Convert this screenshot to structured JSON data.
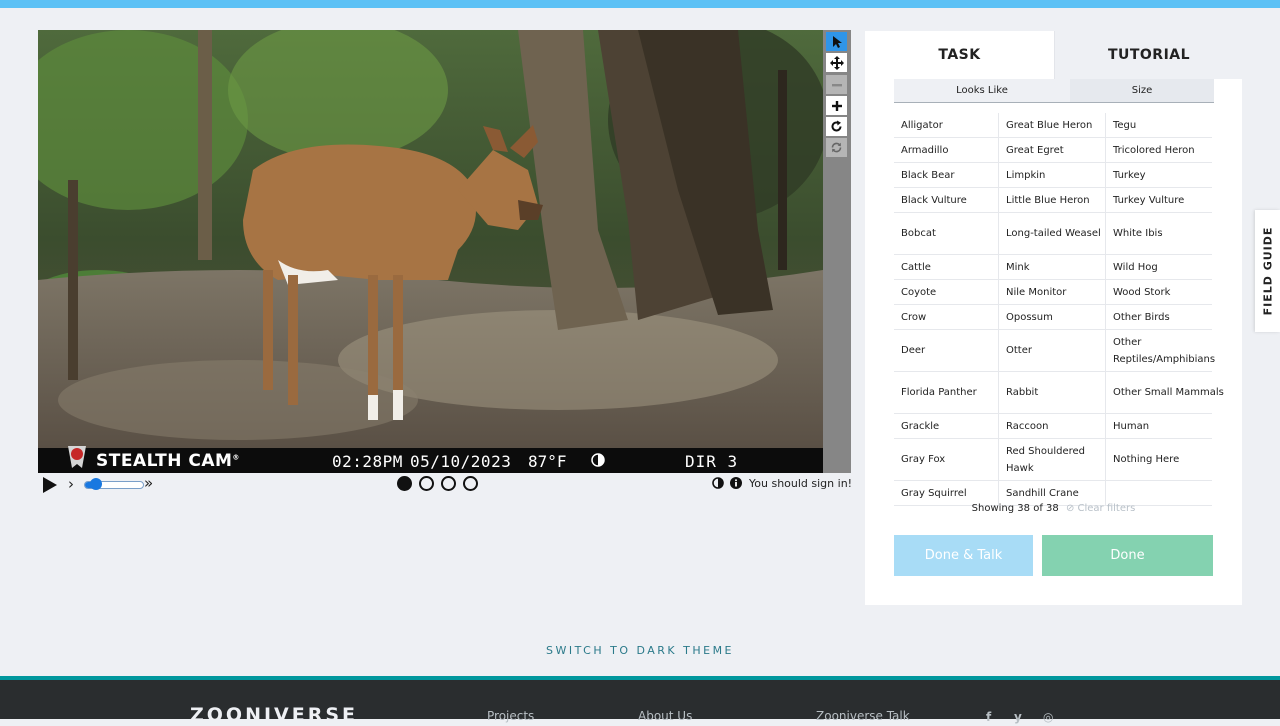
{
  "camera": {
    "brand": "STEALTH CAM",
    "brand_mark": "®",
    "time": "02:28PM",
    "date": "05/10/2023",
    "temp": "87°F",
    "dir": "DIR 3"
  },
  "toolbar": {
    "icons": [
      "pointer-icon",
      "move-icon",
      "zoom-out-icon",
      "zoom-in-icon",
      "rotate-icon",
      "reset-icon"
    ]
  },
  "controls": {
    "slow_label": "›",
    "fast_label": "»",
    "frames_total": 4,
    "frame_current": 1,
    "signin_note": "You should sign in!"
  },
  "task": {
    "tabs": {
      "task": "TASK",
      "tutorial": "TUTORIAL"
    },
    "filters": {
      "looks_like": "Looks Like",
      "size": "Size"
    },
    "rows": [
      [
        "Alligator",
        "Great Blue Heron",
        "Tegu"
      ],
      [
        "Armadillo",
        "Great Egret",
        "Tricolored Heron"
      ],
      [
        "Black Bear",
        "Limpkin",
        "Turkey"
      ],
      [
        "Black Vulture",
        "Little Blue Heron",
        "Turkey Vulture"
      ],
      [
        "Bobcat",
        "Long-tailed Weasel",
        "White Ibis"
      ],
      [
        "Cattle",
        "Mink",
        "Wild Hog"
      ],
      [
        "Coyote",
        "Nile Monitor",
        "Wood Stork"
      ],
      [
        "Crow",
        "Opossum",
        "Other Birds"
      ],
      [
        "Deer",
        "Otter",
        "Other Reptiles/Amphibians"
      ],
      [
        "Florida Panther",
        "Rabbit",
        "Other Small Mammals"
      ],
      [
        "Grackle",
        "Raccoon",
        "Human"
      ],
      [
        "Gray Fox",
        "Red Shouldered Hawk",
        "Nothing Here"
      ],
      [
        "Gray Squirrel",
        "Sandhill Crane",
        ""
      ]
    ],
    "showing": "Showing 38 of 38",
    "clear_filters": "Clear filters",
    "done_talk": "Done & Talk",
    "done": "Done"
  },
  "field_guide": "FIELD GUIDE",
  "theme_toggle": "SWITCH TO DARK THEME",
  "footer": {
    "logo": "ZOONIVERSE",
    "links": [
      "Projects",
      "About Us",
      "Zooniverse Talk"
    ],
    "social": [
      "f",
      "y",
      "◎"
    ]
  },
  "colors": {
    "accent": "#5cc1f5",
    "done": "#84d2b0",
    "done_talk": "#a8dcf6",
    "footer": "#2a2d2f",
    "footer_rule": "#00979d"
  }
}
